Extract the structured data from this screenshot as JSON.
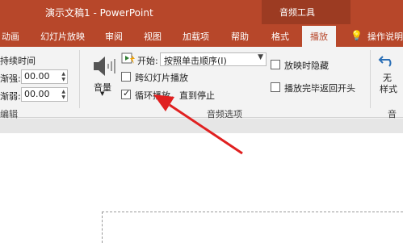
{
  "window": {
    "title": "演示文稿1  -  PowerPoint"
  },
  "context_group": "音频工具",
  "tabs": [
    "动画",
    "幻灯片放映",
    "审阅",
    "视图",
    "加载项",
    "帮助",
    "格式",
    "播放",
    "操作说明"
  ],
  "timing": {
    "duration_label": "持续时间",
    "fade_in_label": "渐强:",
    "fade_in_value": "00.00",
    "fade_out_label": "渐弱:",
    "fade_out_value": "00.00",
    "group_label": "编辑"
  },
  "audio_options": {
    "volume_label": "音量",
    "start_label": "开始:",
    "start_value": "按照单击顺序(I)",
    "play_across_slides": "跨幻灯片播放",
    "loop_until_stopped": "循环播放，直到停止",
    "hide_during_show": "放映时隐藏",
    "rewind_after_playing": "播放完毕返回开头",
    "group_label": "音频选项",
    "loop_checked": true
  },
  "styles": {
    "no_style_line1": "无",
    "no_style_line2": "样式",
    "group_label_partial": "音"
  },
  "colors": {
    "titlebar": "#b7472a",
    "annotation_arrow": "#e02020"
  }
}
